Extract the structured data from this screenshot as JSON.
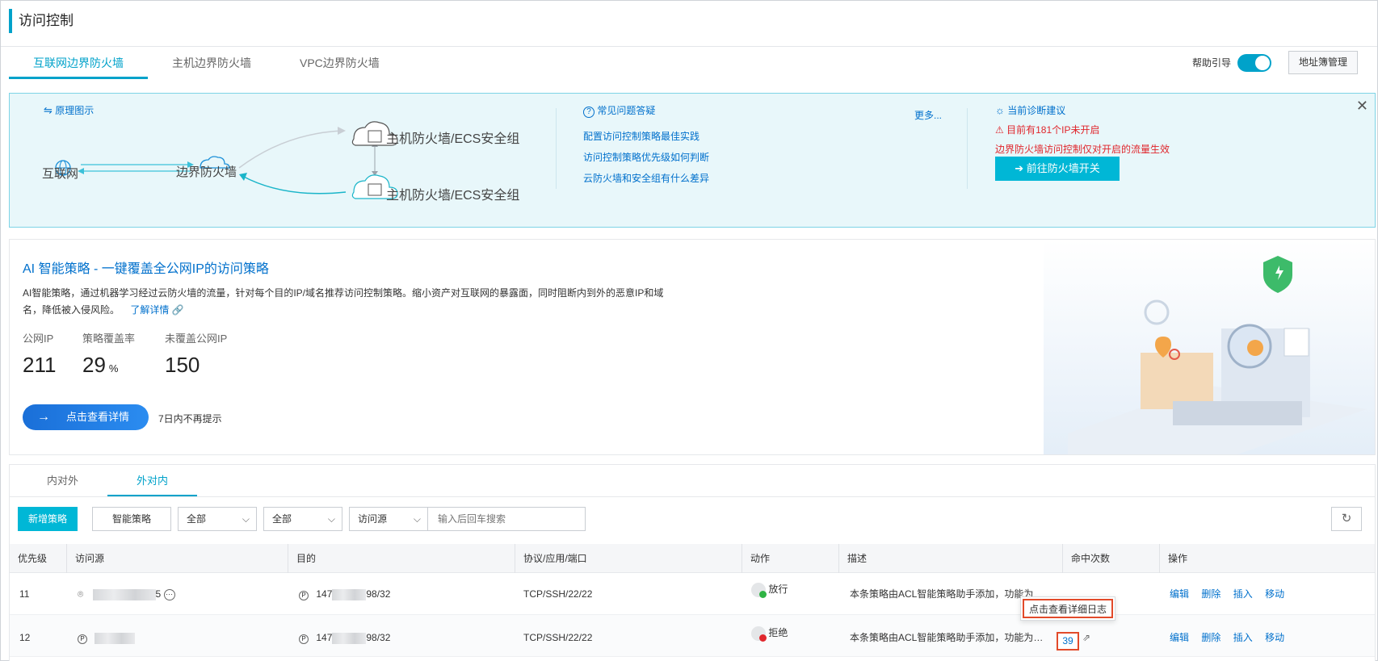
{
  "header": {
    "title": "访问控制"
  },
  "tabs": [
    {
      "label": "互联网边界防火墙",
      "active": true
    },
    {
      "label": "主机边界防火墙"
    },
    {
      "label": "VPC边界防火墙"
    }
  ],
  "help": {
    "label": "帮助引导",
    "enabled": true
  },
  "address_button": "地址簿管理",
  "banner": {
    "principle_label": "原理图示",
    "nodes": {
      "internet": "互联网",
      "border_fw": "边界防火墙",
      "host_fw_1": "主机防火墙/ECS安全组",
      "host_fw_2": "主机防火墙/ECS安全组"
    },
    "faq_title": "常见问题答疑",
    "faq_more": "更多...",
    "faq_items": [
      "配置访问控制策略最佳实践",
      "访问控制策略优先级如何判断",
      "云防火墙和安全组有什么差异"
    ],
    "diag_title": "当前诊断建议",
    "diag_warning": "目前有181个IP未开启",
    "diag_note": "边界防火墙访问控制仅对开启的流量生效",
    "diag_button": "前往防火墙开关"
  },
  "ai": {
    "title": "AI 智能策略 - 一键覆盖全公网IP的访问策略",
    "desc": "AI智能策略，通过机器学习经过云防火墙的流量，针对每个目的IP/域名推荐访问控制策略。缩小资产对互联网的暴露面，同时阻断内到外的恶意IP和域名，降低被入侵风险。",
    "learn_more": "了解详情",
    "stats": [
      {
        "label": "公网IP",
        "value": "211",
        "unit": ""
      },
      {
        "label": "策略覆盖率",
        "value": "29",
        "unit": "%"
      },
      {
        "label": "未覆盖公网IP",
        "value": "150",
        "unit": ""
      }
    ],
    "detail_button": "点击查看详情",
    "dismiss": "7日内不再提示"
  },
  "policy": {
    "subtabs": [
      {
        "label": "内对外"
      },
      {
        "label": "外对内",
        "active": true
      }
    ],
    "add_button": "新增策略",
    "smart_button": "智能策略",
    "filter1": "全部",
    "filter2": "全部",
    "filter3": "访问源",
    "search_placeholder": "输入后回车搜索",
    "columns": [
      "优先级",
      "访问源",
      "目的",
      "协议/应用/端口",
      "动作",
      "描述",
      "命中次数",
      "操作"
    ],
    "rows": [
      {
        "priority": "11",
        "source_suffix": "5",
        "dest_prefix": "147",
        "dest_suffix": "98/32",
        "proto": "TCP/SSH/22/22",
        "action": "放行",
        "action_color": "#2fb344",
        "desc": "本条策略由ACL智能策略助手添加，功能为",
        "hits": "",
        "ops": [
          "编辑",
          "删除",
          "插入",
          "移动"
        ]
      },
      {
        "priority": "12",
        "source_suffix": "",
        "dest_prefix": "147",
        "dest_suffix": "98/32",
        "proto": "TCP/SSH/22/22",
        "action": "拒绝",
        "action_color": "#e0262c",
        "desc": "本条策略由ACL智能策略助手添加，功能为…",
        "hits": "39",
        "ops": [
          "编辑",
          "删除",
          "插入",
          "移动"
        ]
      }
    ],
    "tooltip": "点击查看详细日志"
  }
}
